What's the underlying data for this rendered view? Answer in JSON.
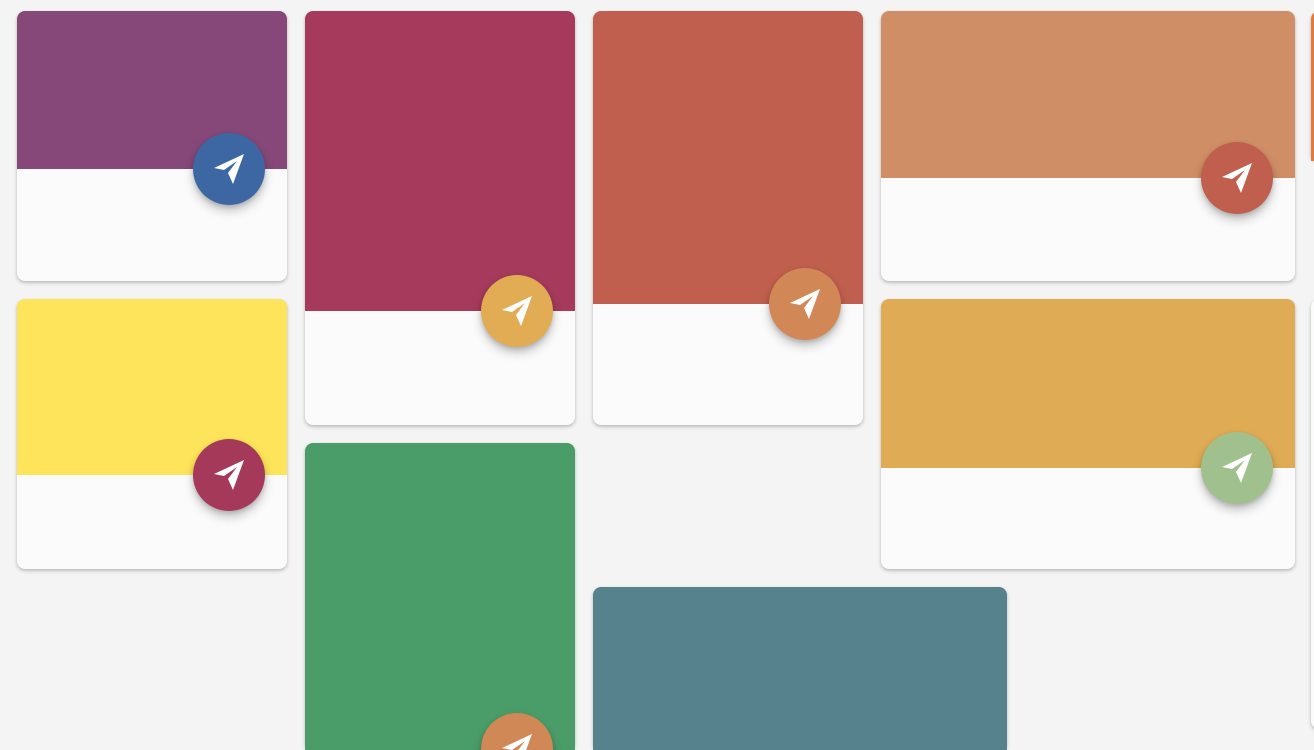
{
  "cards": [
    {
      "id": "card-1",
      "accent": "#854879",
      "fab_color": "#3c67a3",
      "icon": "paper-plane-icon"
    },
    {
      "id": "card-2",
      "accent": "#a53a5c",
      "fab_color": "#e1ac53",
      "icon": "paper-plane-icon"
    },
    {
      "id": "card-3",
      "accent": "#c05f4e",
      "fab_color": "#d28856",
      "icon": "paper-plane-icon"
    },
    {
      "id": "card-4",
      "accent": "#d08e66",
      "fab_color": "#c05f4e",
      "icon": "paper-plane-icon"
    },
    {
      "id": "card-5",
      "accent": "#fde45a",
      "fab_color": "#a5395a",
      "icon": "paper-plane-icon"
    },
    {
      "id": "card-6",
      "accent": "#df ab54",
      "fab_color": "#a0c18d",
      "icon": "paper-plane-icon"
    },
    {
      "id": "card-7",
      "accent": "#4a9d68",
      "fab_color": "#d08856",
      "icon": "paper-plane-icon"
    },
    {
      "id": "card-8",
      "accent": "#56828e",
      "fab_color": "",
      "icon": ""
    }
  ]
}
